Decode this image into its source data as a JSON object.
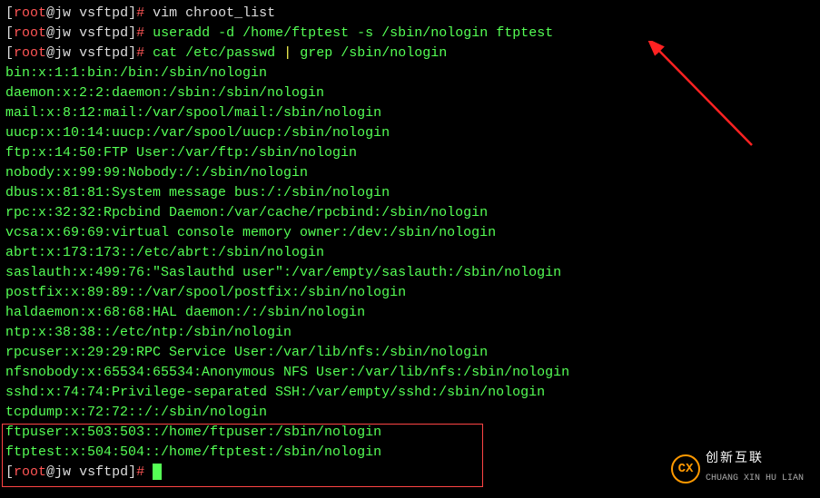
{
  "prompt": {
    "user": "root",
    "host": "jw",
    "cwd": "vsftpd",
    "symbol": "#"
  },
  "commands": {
    "c1": "vim chroot_list",
    "c2": "useradd -d /home/ftptest -s /sbin/nologin ftptest",
    "c3_part1": "cat /etc/passwd",
    "c3_pipe": "|",
    "c3_part2": "grep /sbin/nologin"
  },
  "output": {
    "l1": "bin:x:1:1:bin:/bin:/sbin/nologin",
    "l2": "daemon:x:2:2:daemon:/sbin:/sbin/nologin",
    "l3": "mail:x:8:12:mail:/var/spool/mail:/sbin/nologin",
    "l4": "uucp:x:10:14:uucp:/var/spool/uucp:/sbin/nologin",
    "l5": "ftp:x:14:50:FTP User:/var/ftp:/sbin/nologin",
    "l6": "nobody:x:99:99:Nobody:/:/sbin/nologin",
    "l7": "dbus:x:81:81:System message bus:/:/sbin/nologin",
    "l8": "rpc:x:32:32:Rpcbind Daemon:/var/cache/rpcbind:/sbin/nologin",
    "l9": "vcsa:x:69:69:virtual console memory owner:/dev:/sbin/nologin",
    "l10": "abrt:x:173:173::/etc/abrt:/sbin/nologin",
    "l11": "saslauth:x:499:76:\"Saslauthd user\":/var/empty/saslauth:/sbin/nologin",
    "l12": "postfix:x:89:89::/var/spool/postfix:/sbin/nologin",
    "l13": "haldaemon:x:68:68:HAL daemon:/:/sbin/nologin",
    "l14": "ntp:x:38:38::/etc/ntp:/sbin/nologin",
    "l15": "rpcuser:x:29:29:RPC Service User:/var/lib/nfs:/sbin/nologin",
    "l16": "nfsnobody:x:65534:65534:Anonymous NFS User:/var/lib/nfs:/sbin/nologin",
    "l17": "sshd:x:74:74:Privilege-separated SSH:/var/empty/sshd:/sbin/nologin",
    "l18": "tcpdump:x:72:72::/:/sbin/nologin",
    "l19": "ftpuser:x:503:503::/home/ftpuser:/sbin/nologin",
    "l20": "ftptest:x:504:504::/home/ftptest:/sbin/nologin"
  },
  "logo": {
    "abbr": "CX",
    "text_big": "创新互联",
    "text_small": "CHUANG XIN HU LIAN"
  }
}
